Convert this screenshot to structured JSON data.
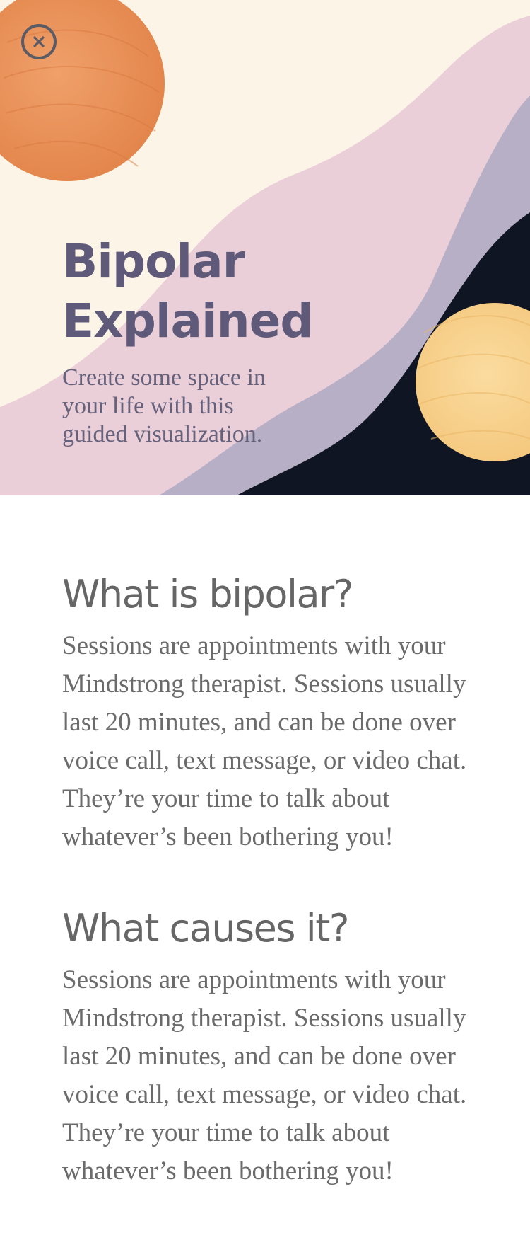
{
  "header": {
    "close_icon": "close-circle-x-icon",
    "title": "Bipolar Explained",
    "subtitle": "Create some space in your life with this guided visualization."
  },
  "colors": {
    "cream": "#fcf4e6",
    "orange": "#ec955a",
    "pink": "#eacfd9",
    "lavender": "#b7afc5",
    "navy": "#0f1522",
    "yellow": "#f9d390",
    "title_text": "#5f5a7a",
    "body_text": "#6b6b6b"
  },
  "sections": [
    {
      "heading": "What is bipolar?",
      "body": "Sessions are appointments with your Mindstrong therapist. Sessions usually last 20 minutes, and can be done over voice call, text message, or video chat. They’re your time to talk about whatever’s been bothering you!"
    },
    {
      "heading": "What causes it?",
      "body": "Sessions are appointments with your Mindstrong therapist. Sessions usually last 20 minutes, and can be done over voice call, text message, or video chat. They’re your time to talk about whatever’s been bothering you!"
    }
  ]
}
